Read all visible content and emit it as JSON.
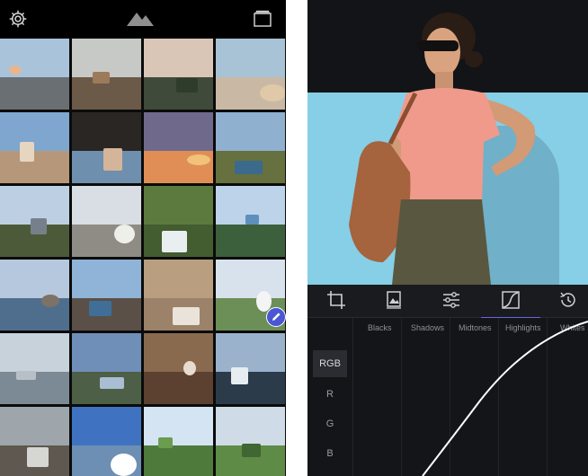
{
  "editor": {
    "tone_bands": [
      "Blacks",
      "Shadows",
      "Midtones",
      "Highlights",
      "Whites"
    ],
    "channels": [
      "RGB",
      "R",
      "G",
      "B"
    ],
    "selected_channel": "RGB",
    "active_tool": "curves"
  },
  "gallery": {
    "tiles": [
      {
        "name": "photo-balcony-sunset",
        "sky": "#a9c3da",
        "ground": "#6a6f74",
        "accent": "#e9b58f"
      },
      {
        "name": "photo-old-buildings",
        "sky": "#c7c9c6",
        "ground": "#6b5a48",
        "accent": "#9b7b5a"
      },
      {
        "name": "photo-palm-dusk",
        "sky": "#d9c6b6",
        "ground": "#3f4a3a",
        "accent": "#2e3d2b"
      },
      {
        "name": "photo-church-tower",
        "sky": "#a8c2d6",
        "ground": "#c9b9a4",
        "accent": "#e0c9a8"
      },
      {
        "name": "photo-coast-town",
        "sky": "#7ea6cf",
        "ground": "#b79779",
        "accent": "#e7d6bf"
      },
      {
        "name": "photo-man-portrait",
        "sky": "#2a2623",
        "ground": "#6f8fae",
        "accent": "#d4b59a"
      },
      {
        "name": "photo-sunset-clouds",
        "sky": "#6f6a8c",
        "ground": "#e08e55",
        "accent": "#f0c27a"
      },
      {
        "name": "photo-rocky-shore",
        "sky": "#8fb0cf",
        "ground": "#67703f",
        "accent": "#3b6a8c"
      },
      {
        "name": "photo-cloudy-cliff",
        "sky": "#bdd0e3",
        "ground": "#4d5a3a",
        "accent": "#76808a"
      },
      {
        "name": "photo-white-building",
        "sky": "#d8dee4",
        "ground": "#8f8c86",
        "accent": "#efefea"
      },
      {
        "name": "photo-waterfall",
        "sky": "#5c7a3e",
        "ground": "#435c30",
        "accent": "#e9eef0"
      },
      {
        "name": "photo-fjord-hiker",
        "sky": "#bcd3ea",
        "ground": "#3c5f3c",
        "accent": "#5f8fbd"
      },
      {
        "name": "photo-lake-pier",
        "sky": "#b6c8dd",
        "ground": "#4f6e8e",
        "accent": "#7c7266"
      },
      {
        "name": "photo-dock-lake",
        "sky": "#8fb4d8",
        "ground": "#5a5048",
        "accent": "#3f6f98"
      },
      {
        "name": "photo-coffee-table",
        "sky": "#b99e80",
        "ground": "#9c8268",
        "accent": "#e9e3da"
      },
      {
        "name": "photo-snowy-fjord",
        "sky": "#d7e2ec",
        "ground": "#6c8f58",
        "accent": "#f4f4f4"
      },
      {
        "name": "photo-misty-jetty",
        "sky": "#c8d2db",
        "ground": "#7c8a95",
        "accent": "#b8c0c7"
      },
      {
        "name": "photo-valley-river",
        "sky": "#6f8fb8",
        "ground": "#4d5f46",
        "accent": "#a9bdd3"
      },
      {
        "name": "photo-man-sitting",
        "sky": "#8a6a4e",
        "ground": "#5c4030",
        "accent": "#e7dccf"
      },
      {
        "name": "photo-mountain-lake",
        "sky": "#9bb2cc",
        "ground": "#2b3b4a",
        "accent": "#e6ecf0"
      },
      {
        "name": "photo-glass-room",
        "sky": "#9fa6ab",
        "ground": "#5e5850",
        "accent": "#d6d6d2"
      },
      {
        "name": "photo-blue-sky-sea",
        "sky": "#3f73c2",
        "ground": "#6c8fb3",
        "accent": "#ffffff"
      },
      {
        "name": "photo-green-valley",
        "sky": "#d5e4f3",
        "ground": "#4e7a3c",
        "accent": "#6b9c4f"
      },
      {
        "name": "photo-grassy-hill",
        "sky": "#cfdbe6",
        "ground": "#5e8b45",
        "accent": "#3f6633"
      }
    ]
  },
  "colors": {
    "accent": "#6a66d8",
    "edit_badge": "#4a56d4"
  }
}
